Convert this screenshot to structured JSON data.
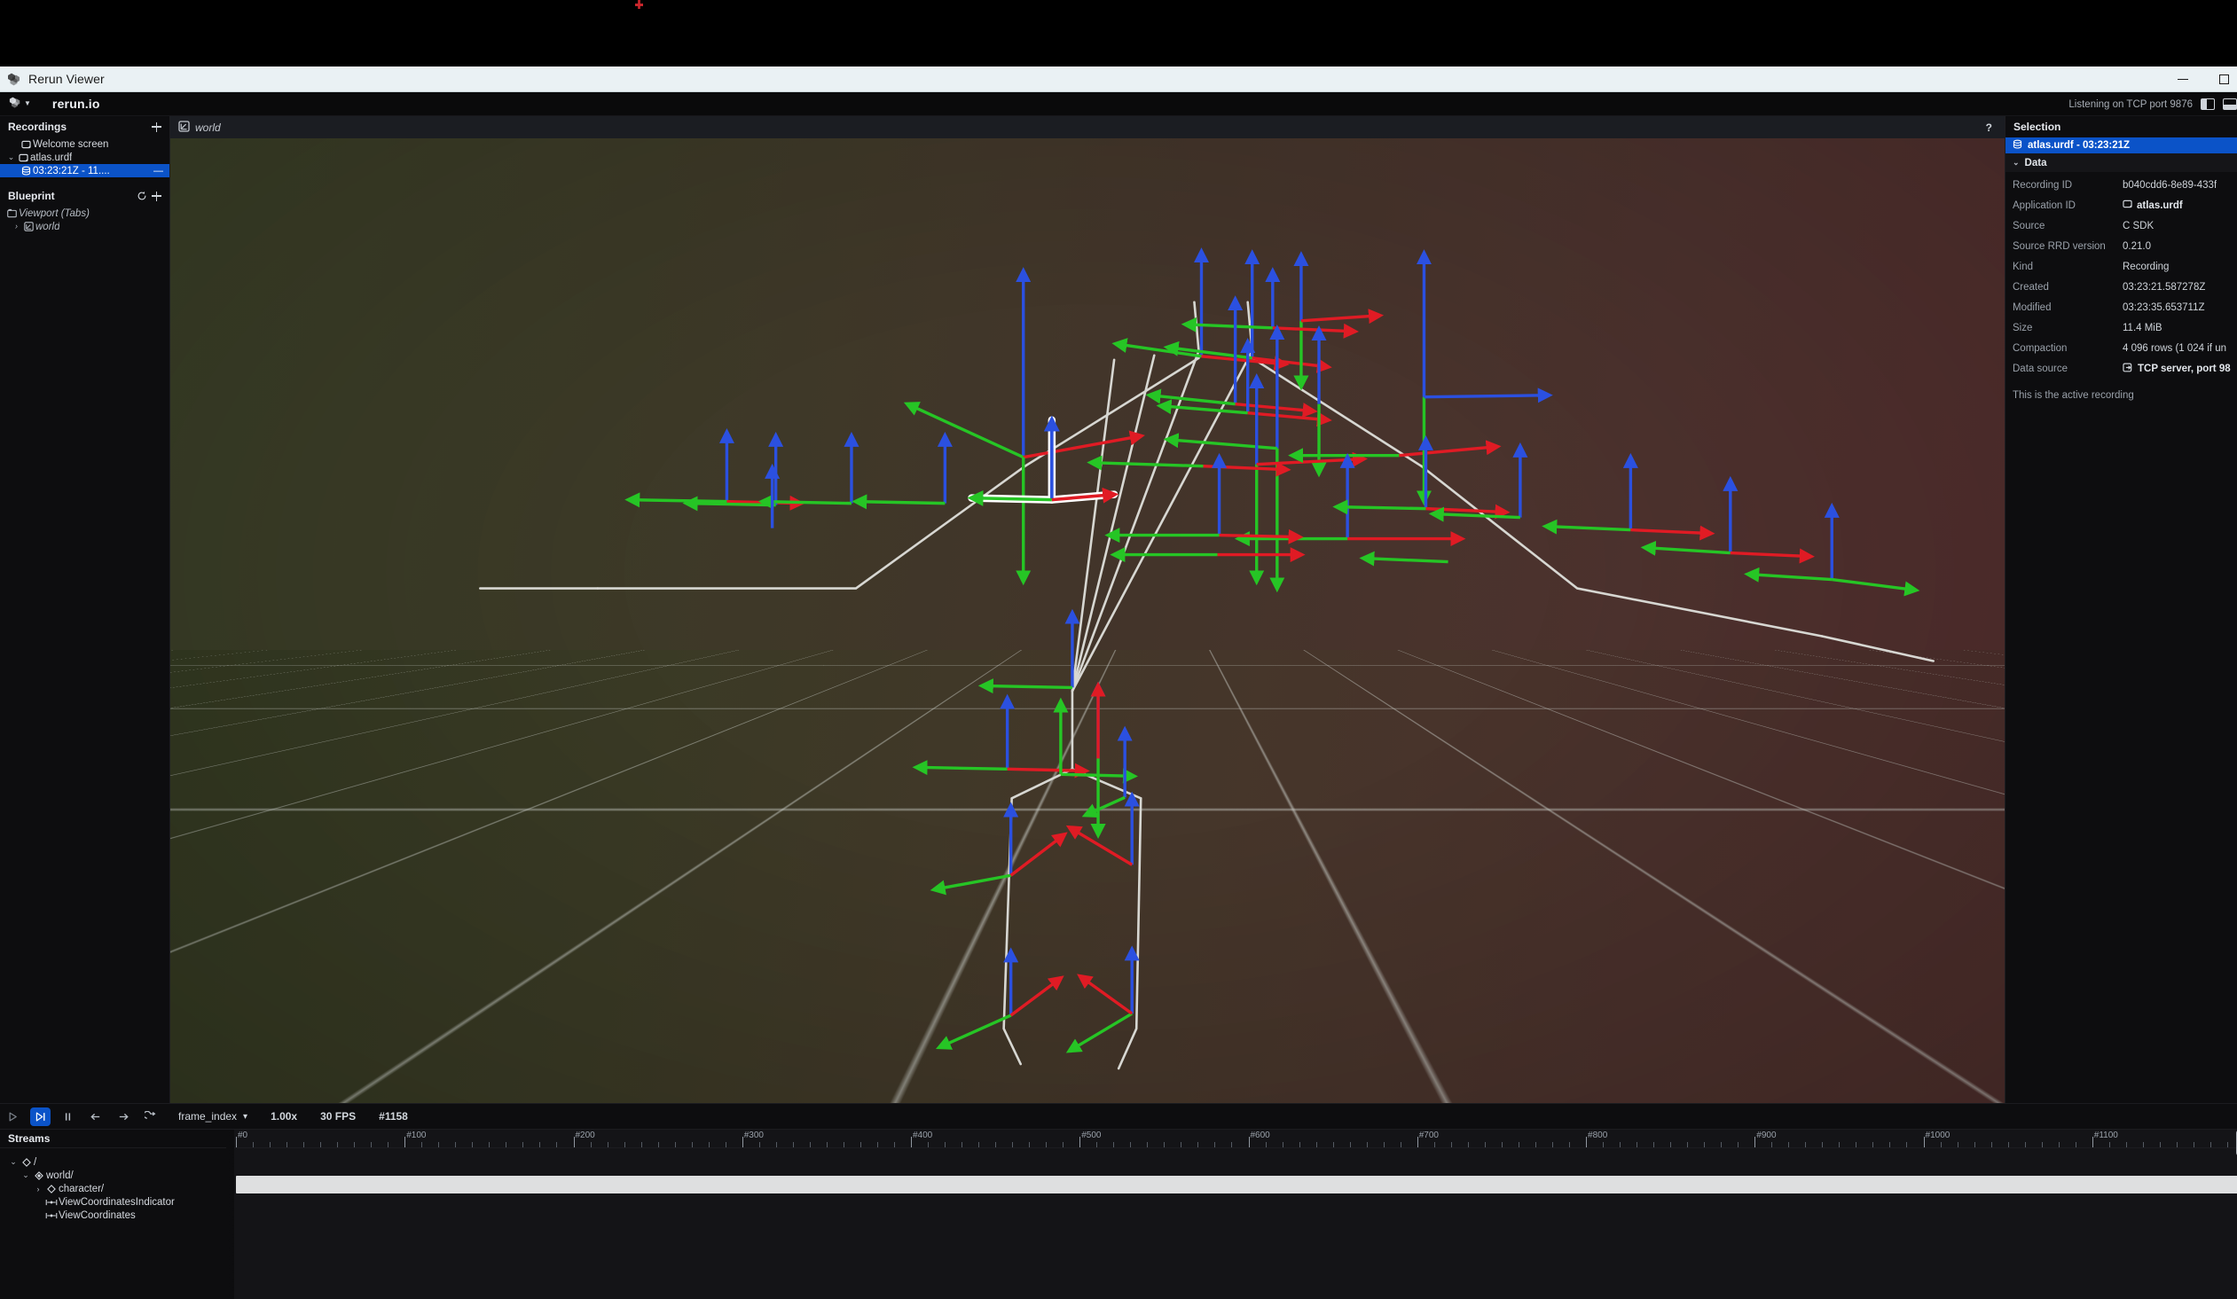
{
  "window": {
    "os_title": "Rerun Viewer",
    "minimize_label": "—",
    "maximize_label": "□"
  },
  "topbar": {
    "menu_icon": "rerun-logo-menu-icon",
    "brand": "rerun.io",
    "status": "Listening on TCP port 9876",
    "toggle_left": "left-panel-toggle-icon",
    "toggle_bottom": "bottom-panel-toggle-icon"
  },
  "left_panel": {
    "recordings": {
      "title": "Recordings",
      "add_label": "+",
      "items": [
        {
          "label": "Welcome screen",
          "icon": "application-icon",
          "depth": 1,
          "caret": "",
          "selected": false,
          "right": ""
        },
        {
          "label": "atlas.urdf",
          "icon": "application-icon",
          "depth": 0,
          "caret": "⌄",
          "selected": false,
          "right": ""
        },
        {
          "label": "03:23:21Z - 11....",
          "icon": "database-icon",
          "depth": 1,
          "caret": "",
          "selected": true,
          "right": "—"
        }
      ]
    },
    "blueprint": {
      "title": "Blueprint",
      "reset_label": "↺",
      "add_label": "+",
      "items": [
        {
          "label": "Viewport (Tabs)",
          "icon": "container-tabs-icon",
          "depth": 0,
          "caret": "",
          "selected": false,
          "right": ""
        },
        {
          "label": "world",
          "icon": "spatial-3d-view-icon",
          "depth": 0,
          "caret": "›",
          "selected": false,
          "right": ""
        }
      ]
    }
  },
  "viewport": {
    "tab_label": "world",
    "tab_icon": "spatial-3d-view-icon",
    "help_label": "?",
    "grid_color": "#d0d4ce",
    "bg_left_color": "#3a3f27",
    "bg_right_color": "#532f2e",
    "axis_colors": {
      "x": "#e01b24",
      "y": "#26c525",
      "z": "#2b50e0"
    },
    "skeleton_color": "#d7d7d2"
  },
  "selection": {
    "title": "Selection",
    "selected_item": "atlas.urdf - 03:23:21Z",
    "selected_icon": "database-icon",
    "group_label": "Data",
    "group_caret": "⌄",
    "rows": [
      {
        "key": "Recording ID",
        "value": "b040cdd6-8e89-433f",
        "icon": ""
      },
      {
        "key": "Application ID",
        "value": "atlas.urdf",
        "icon": "application-icon"
      },
      {
        "key": "Source",
        "value": "C SDK",
        "icon": ""
      },
      {
        "key": "Source RRD version",
        "value": "0.21.0",
        "icon": ""
      },
      {
        "key": "Kind",
        "value": "Recording",
        "icon": ""
      },
      {
        "key": "Created",
        "value": "03:23:21.587278Z",
        "icon": ""
      },
      {
        "key": "Modified",
        "value": "03:23:35.653711Z",
        "icon": ""
      },
      {
        "key": "Size",
        "value": "11.4 MiB",
        "icon": ""
      },
      {
        "key": "Compaction",
        "value": "4 096 rows (1 024 if un",
        "icon": ""
      },
      {
        "key": "Data source",
        "value": "TCP server, port 98",
        "icon": "data-source-icon"
      }
    ],
    "note": "This is the active recording"
  },
  "time_controls": {
    "play": "play-icon",
    "step_forward": "follow-icon",
    "pause": "pause-icon",
    "prev": "arrow-left-icon",
    "next": "arrow-right-icon",
    "loop": "loop-icon",
    "timeline_name": "frame_index",
    "timeline_caret": "▾",
    "speed": "1.00x",
    "fps": "30 FPS",
    "current_frame": "#1158"
  },
  "streams": {
    "title": "Streams",
    "rows": [
      {
        "label": "/",
        "depth": 0,
        "caret": "⌄",
        "icon": "entity-path-icon"
      },
      {
        "label": "world/",
        "depth": 1,
        "caret": "⌄",
        "icon": "entity-path-filled-icon"
      },
      {
        "label": "character/",
        "depth": 2,
        "caret": "›",
        "icon": "entity-path-icon"
      },
      {
        "label": "ViewCoordinatesIndicator",
        "depth": 3,
        "caret": "",
        "icon": "component-icon"
      },
      {
        "label": "ViewCoordinates",
        "depth": 3,
        "caret": "",
        "icon": "component-icon"
      }
    ],
    "ruler": {
      "labels": [
        "#0",
        "#100",
        "#200",
        "#300",
        "#400",
        "#500",
        "#600",
        "#700",
        "#800",
        "#900",
        "#1000",
        "#1100"
      ],
      "start": 0,
      "end": 1158,
      "minor_per_major": 10
    },
    "track_row_index": 2,
    "track_label": ""
  }
}
